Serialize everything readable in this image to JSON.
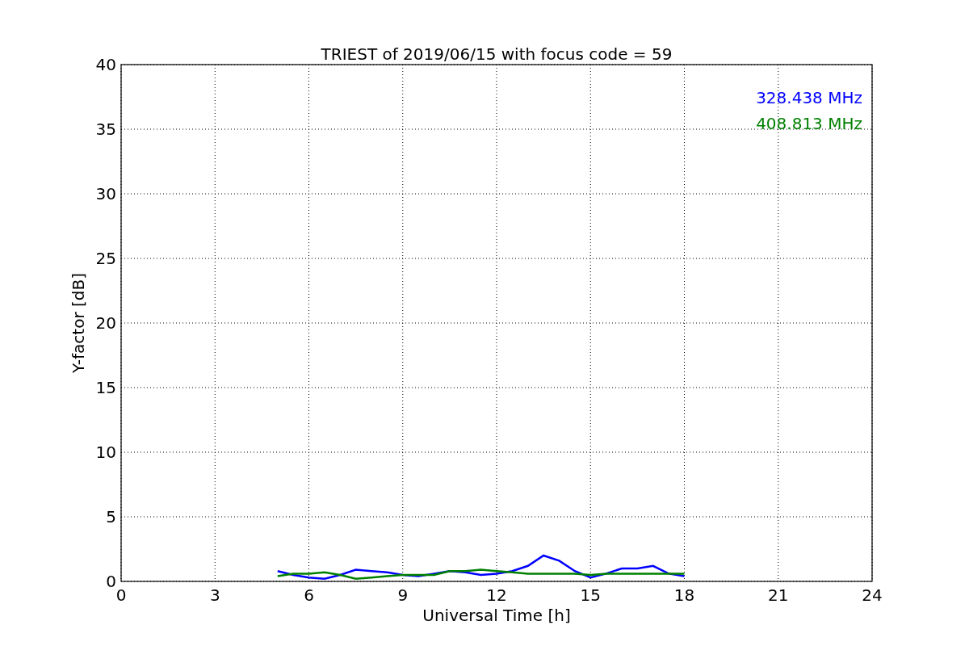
{
  "chart_data": {
    "type": "line",
    "title": "TRIEST of 2019/06/15 with focus code = 59",
    "xlabel": "Universal Time [h]",
    "ylabel": "Y-factor [dB]",
    "x": [
      5,
      5.5,
      6,
      6.5,
      7,
      7.5,
      8,
      8.5,
      9,
      9.5,
      10,
      10.5,
      11,
      11.5,
      12,
      12.5,
      13,
      13.5,
      14,
      14.5,
      15,
      15.5,
      16,
      16.5,
      17,
      17.5,
      18
    ],
    "series": [
      {
        "name": "328.438 MHz",
        "color": "#0000ff",
        "values": [
          0.8,
          0.5,
          0.3,
          0.2,
          0.5,
          0.9,
          0.8,
          0.7,
          0.5,
          0.4,
          0.6,
          0.8,
          0.7,
          0.5,
          0.6,
          0.8,
          1.2,
          2.0,
          1.6,
          0.8,
          0.3,
          0.6,
          1.0,
          1.0,
          1.2,
          0.6,
          0.4
        ]
      },
      {
        "name": "408.813 MHz",
        "color": "#008000",
        "values": [
          0.4,
          0.6,
          0.6,
          0.7,
          0.5,
          0.2,
          0.3,
          0.4,
          0.5,
          0.5,
          0.5,
          0.8,
          0.8,
          0.9,
          0.8,
          0.7,
          0.6,
          0.6,
          0.6,
          0.6,
          0.5,
          0.6,
          0.6,
          0.6,
          0.6,
          0.6,
          0.6
        ]
      }
    ],
    "xlim": [
      0,
      24
    ],
    "ylim": [
      0,
      40
    ],
    "xticks": [
      0,
      3,
      6,
      9,
      12,
      15,
      18,
      21,
      24
    ],
    "yticks": [
      0,
      5,
      10,
      15,
      20,
      25,
      30,
      35,
      40
    ],
    "grid": true
  }
}
